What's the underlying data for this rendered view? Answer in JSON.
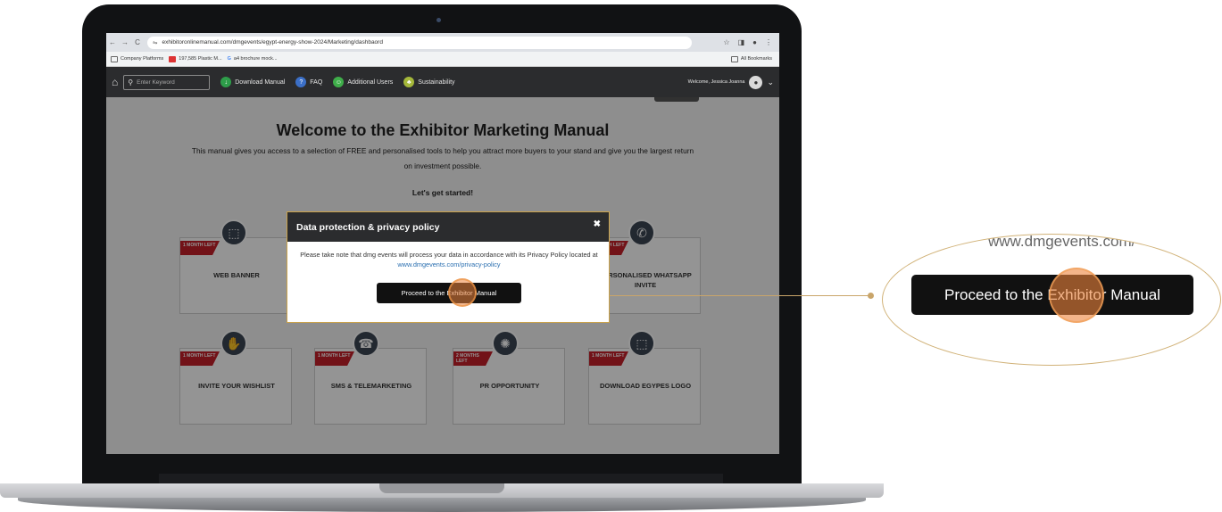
{
  "browser": {
    "url": "exhibitoronlinemanual.com/dmgevents/egypt-energy-show-2024/Marketing/dashbaord",
    "bookmarks": [
      "Company Platforms",
      "197,585 Plastic M...",
      "a4 brochure mock..."
    ],
    "all_bookmarks": "All Bookmarks"
  },
  "header": {
    "search_placeholder": "Enter Keyword",
    "nav": [
      "Download Manual",
      "FAQ",
      "Additional Users",
      "Sustainability"
    ],
    "welcome": "Welcome, Jessica Joanna"
  },
  "main": {
    "title": "Welcome to the Exhibitor Marketing Manual",
    "intro": "This manual gives you access to a selection of FREE and personalised tools to help you attract more buyers to your stand and give you the largest return on investment possible.",
    "lets": "Let's get started!"
  },
  "cards": [
    {
      "ribbon": "1 MONTH LEFT",
      "title": "WEB BANNER"
    },
    {
      "ribbon": "",
      "title": ""
    },
    {
      "ribbon": "",
      "title": ""
    },
    {
      "ribbon": "1 MONTH LEFT",
      "title": "PERSONALISED WHATSAPP INVITE"
    },
    {
      "ribbon": "1 MONTH LEFT",
      "title": "INVITE YOUR WISHLIST"
    },
    {
      "ribbon": "1 MONTH LEFT",
      "title": "SMS & TELEMARKETING"
    },
    {
      "ribbon": "2 MONTHS LEFT",
      "title": "PR OPPORTUNITY"
    },
    {
      "ribbon": "1 MONTH LEFT",
      "title": "DOWNLOAD EGYPES LOGO"
    }
  ],
  "modal": {
    "title": "Data protection & privacy policy",
    "text": "Please take note that dmg events will process your data in accordance with its Privacy Policy located at ",
    "link": "www.dmgevents.com/privacy-policy",
    "button": "Proceed to the Exhibitor Manual"
  },
  "zoom": {
    "url_fragment": "www.dmgevents.com/",
    "button": "Proceed to the Exhibitor Manual"
  },
  "colors": {
    "ribbon": "#c41f2a",
    "header": "#2b2c2e",
    "accent": "#c9a56a",
    "click": "#ec843c"
  }
}
